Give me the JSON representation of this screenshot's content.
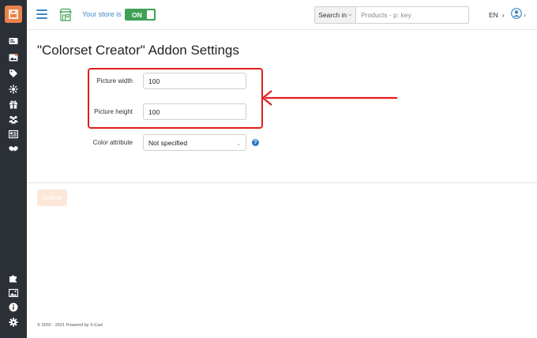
{
  "header": {
    "store_label": "Your store is",
    "store_toggle": "ON",
    "search_button": "Search in",
    "search_placeholder": "Products - p: key",
    "language": "EN",
    "colors": {
      "accent": "#3f88c5",
      "toggle_on": "#3ea155"
    }
  },
  "sidebar": {
    "logo": "xcart-logo-icon",
    "top_icons": [
      "orders-icon",
      "catalog-icon",
      "tags-icon",
      "discounts-icon",
      "gift-icon",
      "users-icon",
      "content-icon",
      "partners-icon"
    ],
    "bottom_icons": [
      "addons-icon",
      "images-icon",
      "info-icon",
      "settings-icon"
    ],
    "colors": {
      "background": "#2b2f36",
      "logo": "#e9834b"
    }
  },
  "page": {
    "title": "\"Colorset Creator\" Addon Settings",
    "fields": {
      "picture_width": {
        "label": "Picture width",
        "value": "100"
      },
      "picture_height": {
        "label": "Picture height",
        "value": "100"
      },
      "color_attribute": {
        "label": "Color attribute",
        "value": "Not specified"
      }
    },
    "help_glyph": "?",
    "submit_label": "Submit",
    "annotation_color": "#e01e1e"
  },
  "footer": {
    "text": "© 2002 - 2021 Powered by X-Cart"
  }
}
